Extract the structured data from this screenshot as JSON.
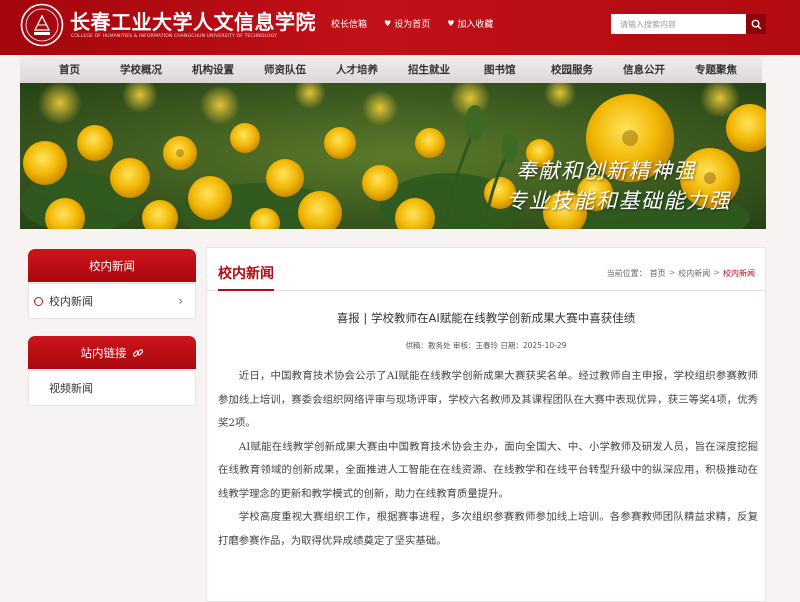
{
  "header": {
    "logo_cn": "长春工业大学人文信息学院",
    "logo_en": "COLLEGE OF HUMANITIES & INFORMATION CHANGCHUN UNIVERSITY OF TECHNOLOGY",
    "quick_links": [
      {
        "label": "校长信箱",
        "icon": "mail-icon"
      },
      {
        "label": "设为首页",
        "icon": "home-icon"
      },
      {
        "label": "加入收藏",
        "icon": "plus-icon"
      }
    ],
    "search_placeholder": "请输入搜索内容",
    "brand_color": "#b30b12"
  },
  "nav": {
    "items": [
      "首页",
      "学校概况",
      "机构设置",
      "师资队伍",
      "人才培养",
      "招生就业",
      "图书馆",
      "校园服务",
      "信息公开",
      "专题聚焦"
    ]
  },
  "banner": {
    "line1": "奉献和创新精神强",
    "line2": "专业技能和基础能力强"
  },
  "sidebar": {
    "section1_title": "校内新闻",
    "section1_items": [
      {
        "label": "校内新闻",
        "icon": "circle-bullet-icon"
      }
    ],
    "section2_title": "站内链接",
    "section2_icon": "link-icon",
    "section2_items": [
      {
        "label": "视频新闻"
      }
    ]
  },
  "main": {
    "title": "校内新闻",
    "breadcrumb": {
      "prefix": "当前位置：",
      "items": [
        "首页",
        "校内新闻",
        "校内新闻"
      ],
      "separator": ">"
    },
    "article": {
      "title": "喜报 | 学校教师在AI赋能在线教学创新成果大赛中喜获佳绩",
      "meta": "供稿：教务处  审核：王春玲  日期：2025-10-29",
      "paragraphs": [
        "近日，中国教育技术协会公示了AI赋能在线教学创新成果大赛获奖名单。经过教师自主申报，学校组织参赛教师参加线上培训，赛委会组织网络评审与现场评审，学校六名教师及其课程团队在大赛中表现优异，获三等奖4项，优秀奖2项。",
        "AI赋能在线教学创新成果大赛由中国教育技术协会主办，面向全国大、中、小学教师及研发人员，旨在深度挖掘在线教育领域的创新成果，全面推进人工智能在在线资源、在线教学和在线平台转型升级中的纵深应用，积极推动在线教学理念的更新和教学模式的创新，助力在线教育质量提升。",
        "学校高度重视大赛组织工作，根据赛事进程，多次组织参赛教师参加线上培训。各参赛教师团队精益求精，反复打磨参赛作品，为取得优异成绩奠定了坚实基础。"
      ]
    }
  }
}
